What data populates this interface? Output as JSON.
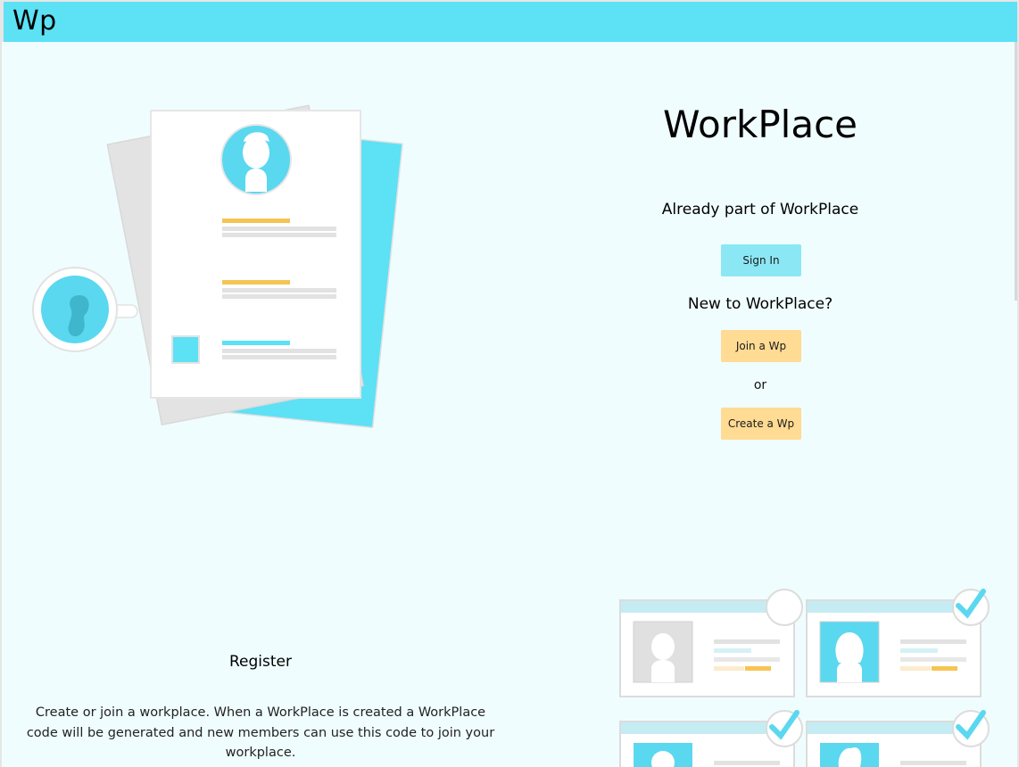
{
  "app": {
    "brand": "Wp"
  },
  "hero": {
    "title": "WorkPlace",
    "signin_prompt": "Already part of WorkPlace",
    "signin_label": "Sign In",
    "new_prompt": "New to WorkPlace?",
    "join_label": "Join a Wp",
    "or_text": "or",
    "create_label": "Create a Wp"
  },
  "register": {
    "title": "Register",
    "description": "Create or join a workplace. When a WorkPlace is created a WorkPlace code will be generated and new members can use this code to join your workplace."
  },
  "colors": {
    "navbar": "#5ce1f5",
    "page_background": "#f0fdfe",
    "signin_button": "#8ce7f4",
    "join_create_buttons": "#ffdb94",
    "accent_yellow": "#f6c453"
  },
  "icons": {
    "resume": "resume-document-illustration",
    "coffee": "coffee-cup-illustration",
    "profiles": "profile-cards-illustration",
    "check": "checkmark-icon"
  }
}
